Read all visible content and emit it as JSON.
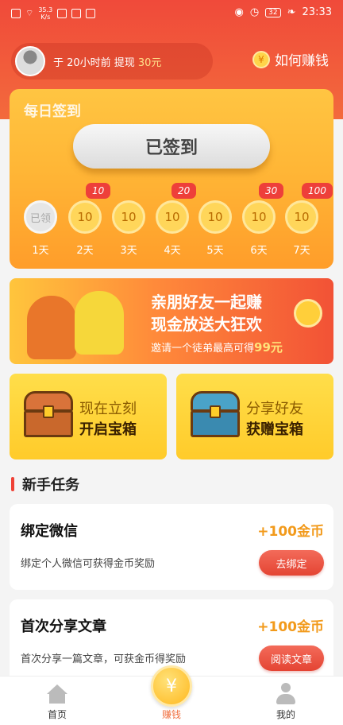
{
  "status_bar": {
    "net_speed_value": "35.3",
    "net_speed_unit": "K/s",
    "battery": "32",
    "time": "23:33"
  },
  "header": {
    "withdraw_text": "于 20小时前 提现",
    "withdraw_amount": "30元",
    "how_to_earn": "如何赚钱",
    "coin_symbol": "¥"
  },
  "checkin": {
    "title": "每日签到",
    "button": "已签到",
    "days": [
      {
        "coin": "已领",
        "label": "1天",
        "badge": ""
      },
      {
        "coin": "10",
        "label": "2天",
        "badge": "10"
      },
      {
        "coin": "10",
        "label": "3天",
        "badge": ""
      },
      {
        "coin": "10",
        "label": "4天",
        "badge": "20"
      },
      {
        "coin": "10",
        "label": "5天",
        "badge": ""
      },
      {
        "coin": "10",
        "label": "6天",
        "badge": "30"
      },
      {
        "coin": "10",
        "label": "7天",
        "badge": "100"
      }
    ]
  },
  "banner": {
    "line1": "亲朋好友一起赚",
    "line2": "现金放送大狂欢",
    "line3_prefix": "邀请一个徒弟最高可得",
    "line3_amount": "99元"
  },
  "chests": [
    {
      "line1": "现在立刻",
      "line2": "开启宝箱"
    },
    {
      "line1": "分享好友",
      "line2": "获赠宝箱"
    }
  ],
  "tasks_section": {
    "title": "新手任务",
    "items": [
      {
        "title": "绑定微信",
        "reward": "+100金币",
        "desc": "绑定个人微信可获得金币奖励",
        "button": "去绑定"
      },
      {
        "title": "首次分享文章",
        "reward": "+100金币",
        "desc": "首次分享一篇文章，可获金币得奖励",
        "button": "阅读文章"
      }
    ]
  },
  "tabbar": {
    "home": "首页",
    "earn": "赚钱",
    "me": "我的",
    "earn_symbol": "¥"
  },
  "colors": {
    "header_red": "#f04a3a",
    "card_orange": "#ffb636",
    "reward_orange": "#f29a1b",
    "active_tab": "#f07040"
  }
}
